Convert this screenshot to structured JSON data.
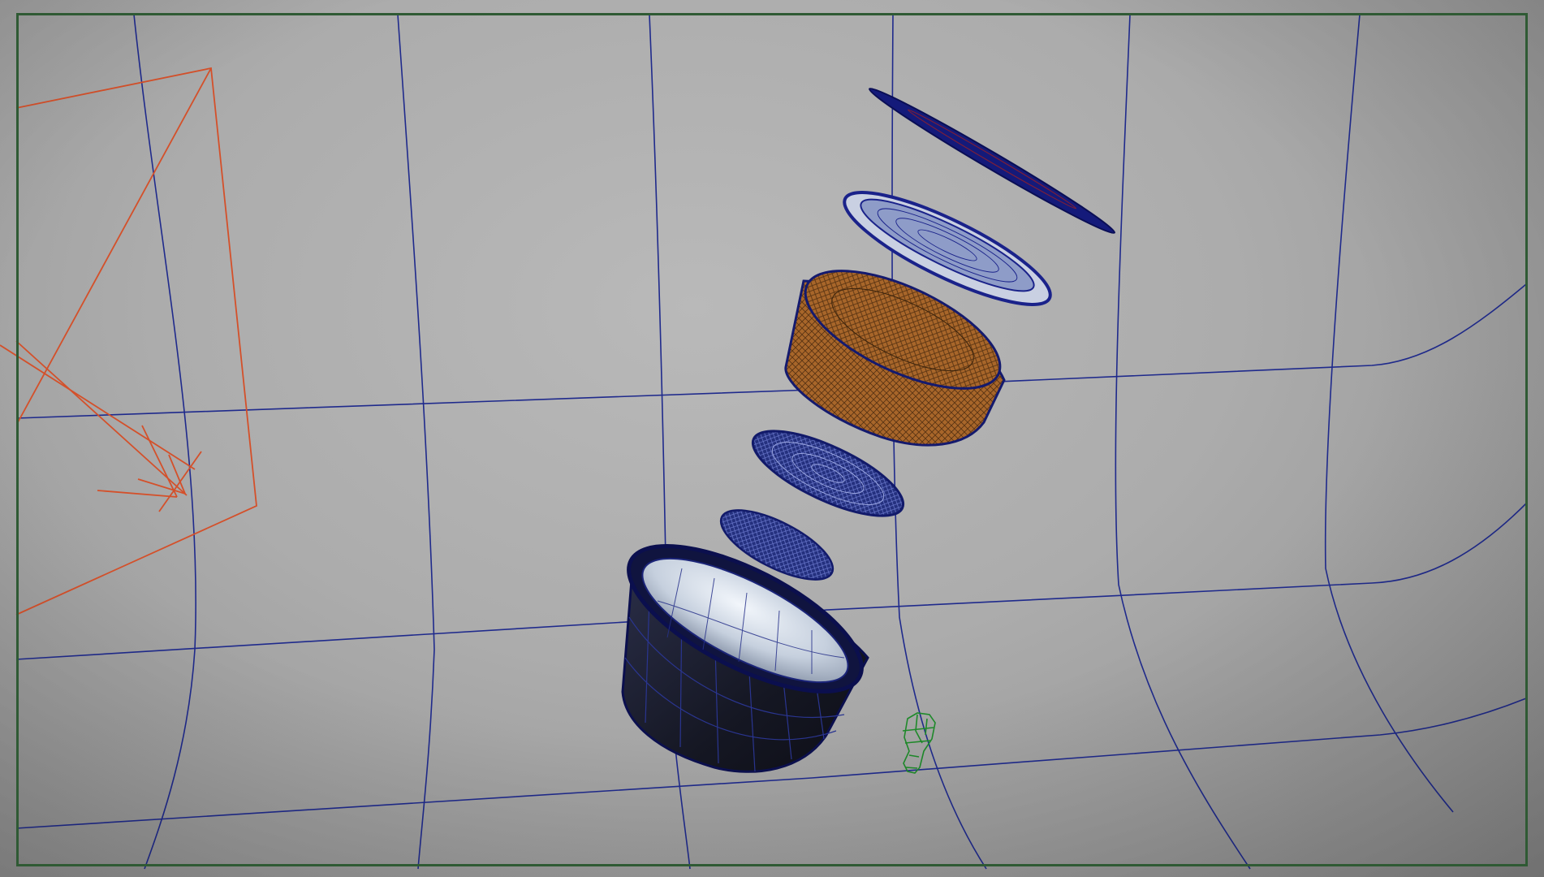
{
  "viewport": {
    "view": "3d-perspective-wireframe-on-shaded",
    "background_color": "#aaaaaa",
    "frame_color": "#2f5a34",
    "grid_color": "#1f2a8c",
    "light_gizmo_color": "#d4502a",
    "locator_color": "#1e8a2a",
    "cork_color": "#a8662a",
    "cup_outer_color": "#1b1d2b",
    "cup_inner_color": "#cfd8e6"
  },
  "scene_objects": [
    "backdrop-sweep",
    "directional-light",
    "lid-foil",
    "lid-rim",
    "coffee-puck",
    "filter-disc",
    "mesh-disc",
    "capsule-cup",
    "figure-locator"
  ]
}
